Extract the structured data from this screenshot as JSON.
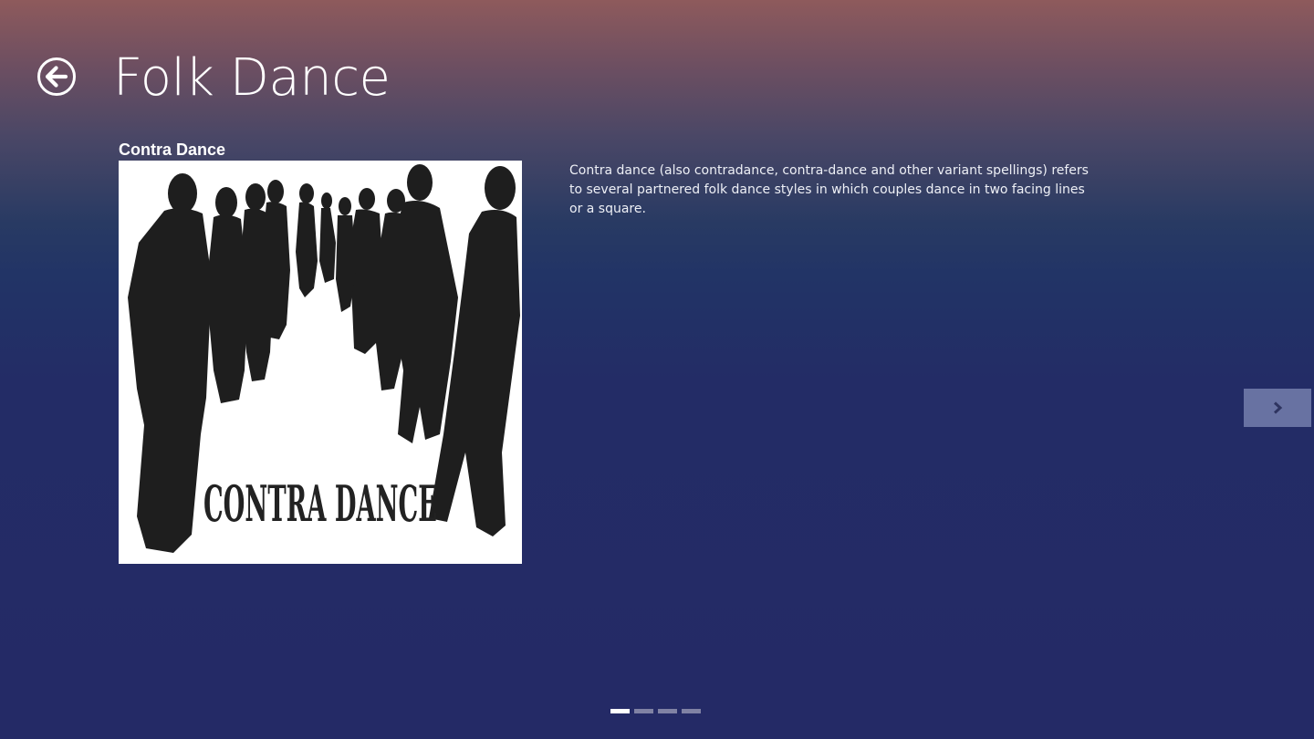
{
  "header": {
    "title": "Folk Dance",
    "back_icon": "back-arrow-circle-icon"
  },
  "item": {
    "title": "Contra Dance",
    "image_text": "CONTRA DANCE",
    "description": "Contra dance (also contradance, contra-dance and other variant spellings) refers to several partnered folk dance styles in which couples dance in two facing lines or a square."
  },
  "navigation": {
    "next_icon": "chevron-right-icon"
  },
  "pager": {
    "count": 4,
    "active_index": 0
  },
  "colors": {
    "background_top": "#8e5a5c",
    "background_bottom": "#242a66",
    "next_button": "#7a82b0",
    "silhouette": "#1e1e1e"
  }
}
